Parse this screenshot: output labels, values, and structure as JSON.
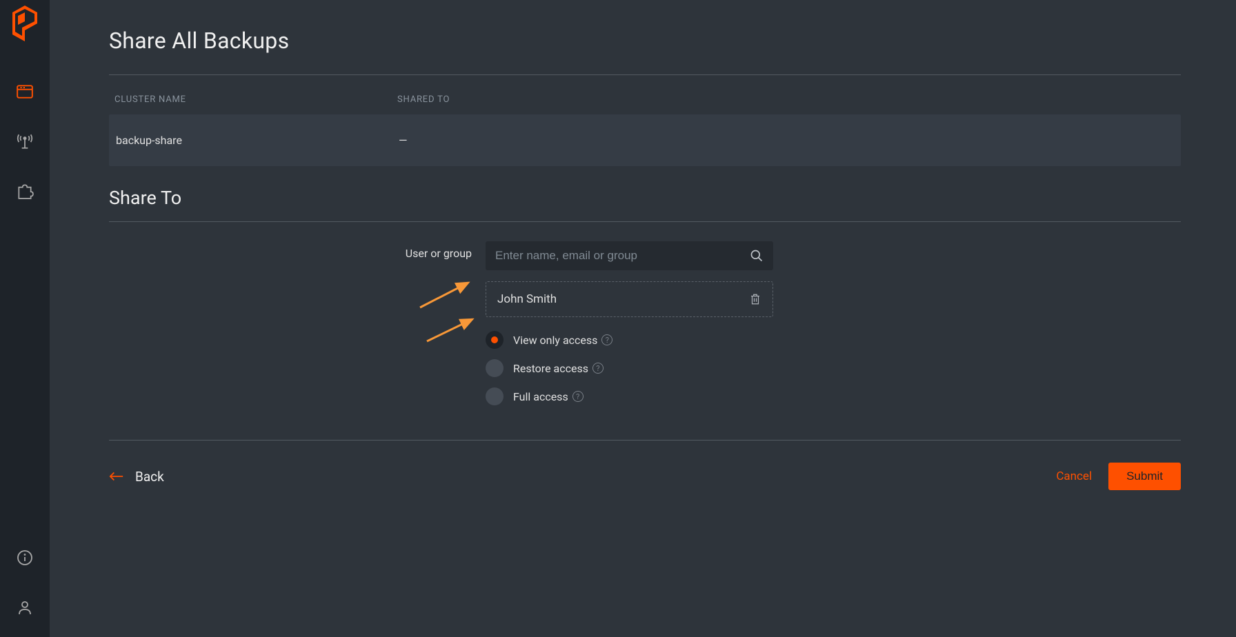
{
  "pageTitle": "Share All Backups",
  "table": {
    "headers": {
      "clusterName": "CLUSTER NAME",
      "sharedTo": "SHARED TO"
    },
    "row": {
      "clusterName": "backup-share",
      "sharedTo": "—"
    }
  },
  "shareSection": {
    "title": "Share To",
    "userOrGroupLabel": "User or group",
    "searchPlaceholder": "Enter name, email or group",
    "selectedUser": "John Smith",
    "accessOptions": {
      "viewOnly": "View only access",
      "restore": "Restore access",
      "full": "Full access"
    }
  },
  "footer": {
    "back": "Back",
    "cancel": "Cancel",
    "submit": "Submit"
  }
}
